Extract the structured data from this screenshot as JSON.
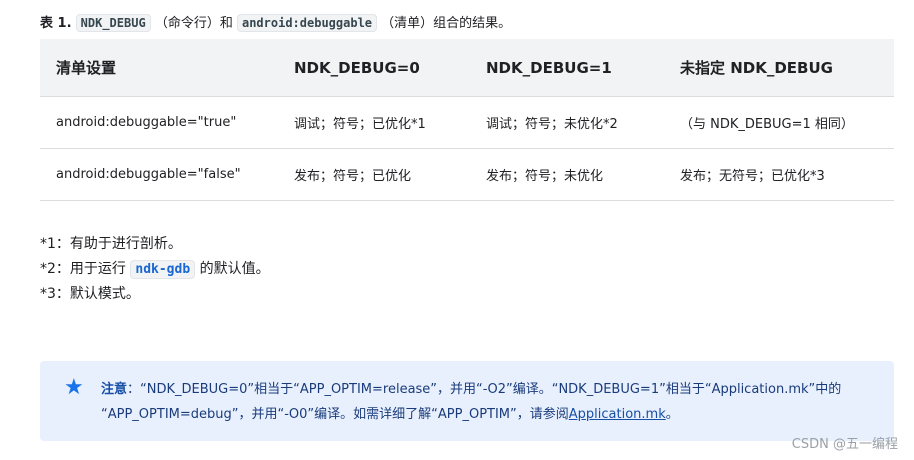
{
  "caption": {
    "label": "表 1.",
    "code1": "NDK_DEBUG",
    "text1": "（命令行）和",
    "code2": "android:debuggable",
    "text2": "（清单）组合的结果。"
  },
  "table": {
    "headers": [
      "清单设置",
      "NDK_DEBUG=0",
      "NDK_DEBUG=1",
      "未指定 NDK_DEBUG"
    ],
    "rows": [
      [
        "android:debuggable=\"true\"",
        "调试；符号；已优化*1",
        "调试；符号；未优化*2",
        "（与 NDK_DEBUG=1 相同）"
      ],
      [
        "android:debuggable=\"false\"",
        "发布；符号；已优化",
        "发布；符号；未优化",
        "发布；无符号；已优化*3"
      ]
    ]
  },
  "notes": {
    "n1": "*1：有助于进行剖析。",
    "n2_prefix": "*2：用于运行",
    "n2_code": "ndk-gdb",
    "n2_suffix": "的默认值。",
    "n3": "*3：默认模式。"
  },
  "callout": {
    "icon": "star-icon",
    "label": "注意",
    "line1": "：“NDK_DEBUG=0”相当于“APP_OPTIM=release”，并用“-O2”编译。“NDK_DEBUG=1”相当于“Application.mk”中的",
    "line2": "“APP_OPTIM=debug”，并用“-O0”编译。如需详细了解“APP_OPTIM”，请参阅",
    "link": "Application.mk",
    "end": "。"
  },
  "watermark": "CSDN @五一编程",
  "colors": {
    "accent": "#1a73e8",
    "callout_bg": "#e8f0fe",
    "header_bg": "#f1f3f4"
  }
}
